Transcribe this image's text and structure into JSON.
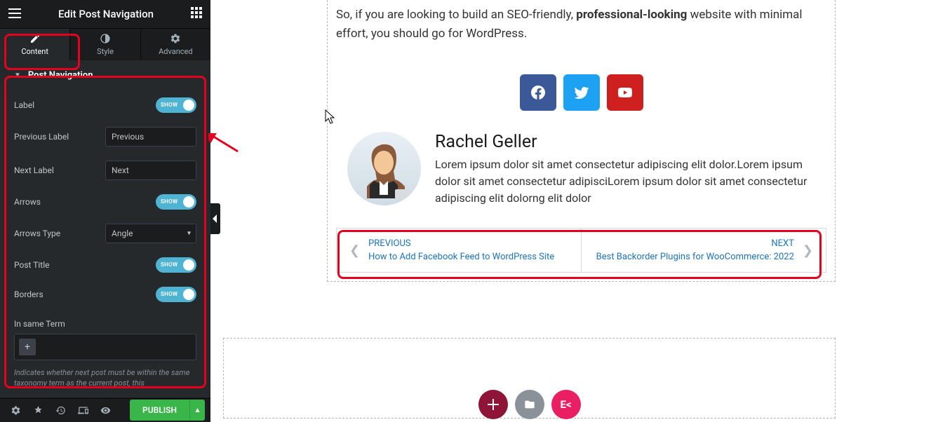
{
  "header": {
    "title": "Edit Post Navigation"
  },
  "tabs": [
    {
      "label": "Content",
      "active": true
    },
    {
      "label": "Style",
      "active": false
    },
    {
      "label": "Advanced",
      "active": false
    }
  ],
  "panel": {
    "title": "Post Navigation",
    "controls": {
      "label_toggle_text": "SHOW",
      "label_label": "Label",
      "prev_label_label": "Previous Label",
      "prev_label_value": "Previous",
      "next_label_label": "Next Label",
      "next_label_value": "Next",
      "arrows_label": "Arrows",
      "arrows_toggle_text": "SHOW",
      "arrows_type_label": "Arrows Type",
      "arrows_type_value": "Angle",
      "post_title_label": "Post Title",
      "post_title_toggle_text": "SHOW",
      "borders_label": "Borders",
      "borders_toggle_text": "SHOW",
      "in_same_term_label": "In same Term",
      "help_text": "Indicates whether next post must be within the same taxonomy term as the current post, this"
    }
  },
  "footer": {
    "publish": "PUBLISH"
  },
  "preview": {
    "paragraph_1": "So, if you are looking to build an SEO-friendly, ",
    "paragraph_bold": "professional-looking",
    "paragraph_2": " website with minimal effort, you should go for WordPress.",
    "author": {
      "name": "Rachel Geller",
      "bio": "Lorem ipsum dolor sit amet consectetur adipiscing elit dolor.Lorem ipsum dolor sit amet consectetur adipisciLorem ipsum dolor sit amet consectetur adipiscing elit dolorng elit dolor"
    },
    "nav": {
      "prev_label": "PREVIOUS",
      "prev_title": "How to Add Facebook Feed to WordPress Site",
      "next_label": "NEXT",
      "next_title": "Best Backorder Plugins for WooCommerce: 2022"
    },
    "action_ek": "E<"
  }
}
